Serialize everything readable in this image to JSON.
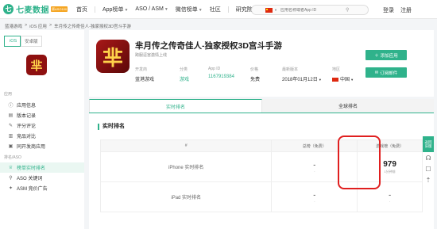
{
  "header": {
    "logo_text": "七麦数据",
    "logo_badge": "原ASO100",
    "nav": [
      {
        "label": "首页",
        "caret": false
      },
      {
        "label": "App榜单",
        "caret": true
      },
      {
        "label": "ASO / ASM",
        "caret": true
      },
      {
        "label": "微信榜单",
        "caret": true
      },
      {
        "label": "社区",
        "caret": false
      },
      {
        "label": "研究院",
        "caret": false
      }
    ],
    "search_placeholder": "应用名称或者App ID",
    "login": "登录",
    "register": "注册"
  },
  "breadcrumb": [
    "蓝港游戏",
    ">",
    "iOS 应用",
    ">",
    "芈月传之传奇佳人-独家授权3D宫斗手游"
  ],
  "sidebar": {
    "platforms": [
      "iOS",
      "安卓版"
    ],
    "group_app": "应用",
    "items_app": [
      {
        "label": "应用信息",
        "icon": "info-icon",
        "glyph": "ⓘ"
      },
      {
        "label": "版本记录",
        "icon": "version-icon",
        "glyph": "▤"
      },
      {
        "label": "评分评论",
        "icon": "comment-icon",
        "glyph": "✎"
      },
      {
        "label": "竞品对比",
        "icon": "compare-icon",
        "glyph": "▥"
      },
      {
        "label": "同开发商应用",
        "icon": "developer-icon",
        "glyph": "▣"
      }
    ],
    "group_rank": "排名/ASO",
    "items_rank": [
      {
        "label": "榜单实时排名",
        "icon": "trophy-icon",
        "glyph": "♕",
        "active": true
      },
      {
        "label": "ASO 关键词",
        "icon": "keyword-icon",
        "glyph": "⚲"
      },
      {
        "label": "ASM 竞价广告",
        "icon": "ad-icon",
        "glyph": "✦"
      }
    ],
    "app_glyph": "芈"
  },
  "app": {
    "icon_glyph": "芈",
    "title": "芈月传之传奇佳人-独家授权3D宫斗手游",
    "subtitle": "跨服逗宫激情上线",
    "meta": [
      {
        "key": "开发商",
        "value": "蓝港游戏",
        "link": false
      },
      {
        "key": "分类",
        "value": "游戏",
        "link": true
      },
      {
        "key": "App ID",
        "value": "1167919384",
        "link": true
      },
      {
        "key": "价格",
        "value": "免费",
        "link": false
      },
      {
        "key": "最新版本",
        "value": "2018年01月12日",
        "link": false
      },
      {
        "key": "地区",
        "value": "中国",
        "link": false
      }
    ],
    "add_button": "添加应用",
    "subscribe_button": "订阅邮件"
  },
  "tabs": [
    {
      "label": "实时排名",
      "active": true
    },
    {
      "label": "全球排名",
      "active": false
    }
  ],
  "ranking": {
    "section_title": "实时排名",
    "columns": [
      "#",
      "总榜（免费）",
      "游戏榜（免费）"
    ],
    "rows": [
      {
        "label": "iPhone 实时排名",
        "overall": "-",
        "overall_sub": "-",
        "game": "979",
        "game_sub": "1分钟前"
      },
      {
        "label": "iPad 实时排名",
        "overall": "-",
        "overall_sub": "-",
        "game": "-",
        "game_sub": "-"
      }
    ]
  },
  "floating": {
    "back_top": "返回\n旧版"
  }
}
